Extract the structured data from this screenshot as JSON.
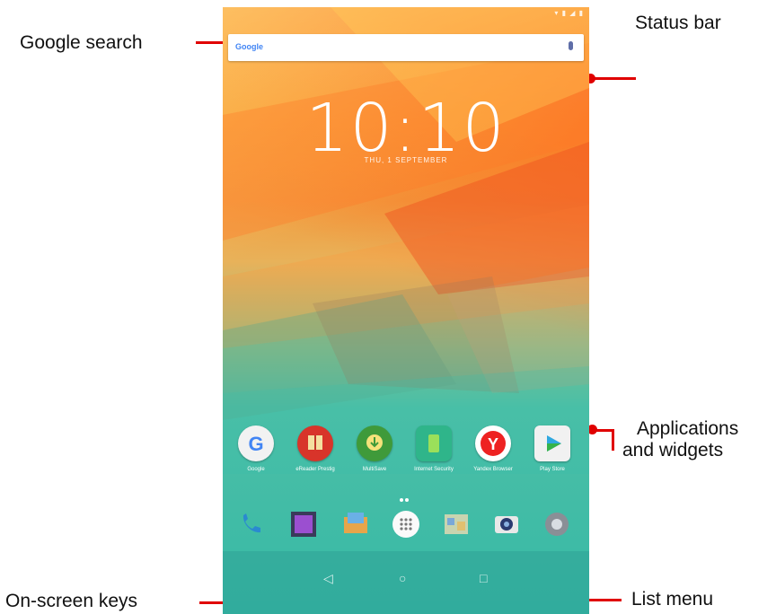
{
  "annotations": {
    "google_search": "Google search",
    "status_bar": "Status bar",
    "applications_line1": "Applications",
    "applications_line2": "and widgets",
    "on_screen_keys": "On-screen keys",
    "list_menu": "List menu"
  },
  "colors": {
    "annotation_line": "#e00000",
    "annotation_text": "#111111"
  },
  "phone": {
    "search": {
      "logo_text": "Google",
      "mic_icon": "mic-icon"
    },
    "clock": {
      "time": "10:10",
      "date": "THU, 1 SEPTEMBER"
    },
    "apps": [
      {
        "name": "Google",
        "icon": "google-icon"
      },
      {
        "name": "eReader Prestig",
        "icon": "ereader-icon"
      },
      {
        "name": "MultiSave",
        "icon": "multisave-icon"
      },
      {
        "name": "Internet Security",
        "icon": "internet-security-icon"
      },
      {
        "name": "Yandex Browser",
        "icon": "yandex-browser-icon"
      },
      {
        "name": "Play Store",
        "icon": "play-store-icon"
      }
    ],
    "dock": [
      {
        "icon": "phone-icon"
      },
      {
        "icon": "gallery-icon"
      },
      {
        "icon": "email-icon"
      },
      {
        "icon": "app-drawer-icon"
      },
      {
        "icon": "file-manager-icon"
      },
      {
        "icon": "camera-icon"
      },
      {
        "icon": "settings-icon"
      }
    ],
    "nav_keys": [
      {
        "icon": "back-icon",
        "glyph": "◁"
      },
      {
        "icon": "home-icon",
        "glyph": "○"
      },
      {
        "icon": "recents-icon",
        "glyph": "□"
      }
    ]
  }
}
